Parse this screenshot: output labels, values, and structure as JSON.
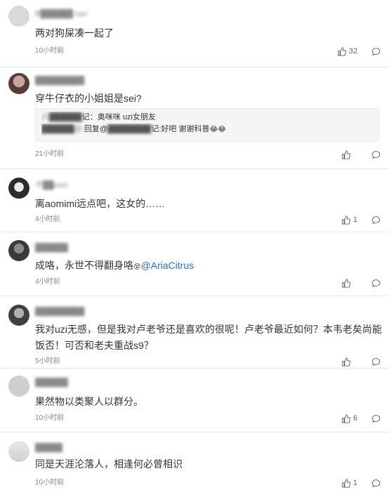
{
  "comments": [
    {
      "username": "B██████ san",
      "text": "两对狗屎凑一起了",
      "time": "10小时前",
      "likes": "32",
      "avatar_color": "#d9d9d9"
    },
    {
      "username": "█████████",
      "text": "穿牛仔衣的小姐姐是sei?",
      "time": "21小时前",
      "likes": "",
      "avatar_color": "#7a5a55",
      "reply_box": {
        "line1_blur": "八██████",
        "line1_text": "记：奥咪咪 uzi女朋友",
        "line2_blur": "██████小",
        "line2_text_a": "回复@",
        "line2_blur_b": "████████",
        "line2_text_b": "记:好吧 谢谢科普",
        "line2_emoji": "😂😂"
      }
    },
    {
      "username": "不██owo",
      "text": "离aomimi远点吧，这女的……",
      "time": "4小时前",
      "likes": "1",
      "avatar_color": "#3d3d3d"
    },
    {
      "username": "██████",
      "text_before": "成咯，永世不得翻身咯",
      "emoji": "😵",
      "mention": "@AriaCitrus",
      "time": "4小时前",
      "likes": "",
      "avatar_color": "#4a4a4a"
    },
    {
      "username": "█████████",
      "text": "我对uzi无感，但是我对卢老爷还是喜欢的很呢！卢老爷最近如何？本韦老矣尚能饭否！可否和老夫重战s9？",
      "time": "5小时前",
      "likes": "",
      "avatar_color": "#5a5a5a"
    },
    {
      "username": "██████",
      "text": "果然物以类聚人以群分。",
      "time": "10小时前",
      "likes": "6",
      "avatar_color": "#cfcfcf"
    },
    {
      "username": "█████",
      "text": "同是天涯沦落人，相逢何必曾相识",
      "time": "10小时前",
      "likes": "1",
      "avatar_color": "#e0e0e0"
    }
  ],
  "colors": {
    "mention": "#2b6bd3",
    "muted": "#888888",
    "divider": "#e6e6e6"
  },
  "icons": {
    "like": "thumbs-up-icon",
    "reply": "comment-bubble-icon"
  }
}
